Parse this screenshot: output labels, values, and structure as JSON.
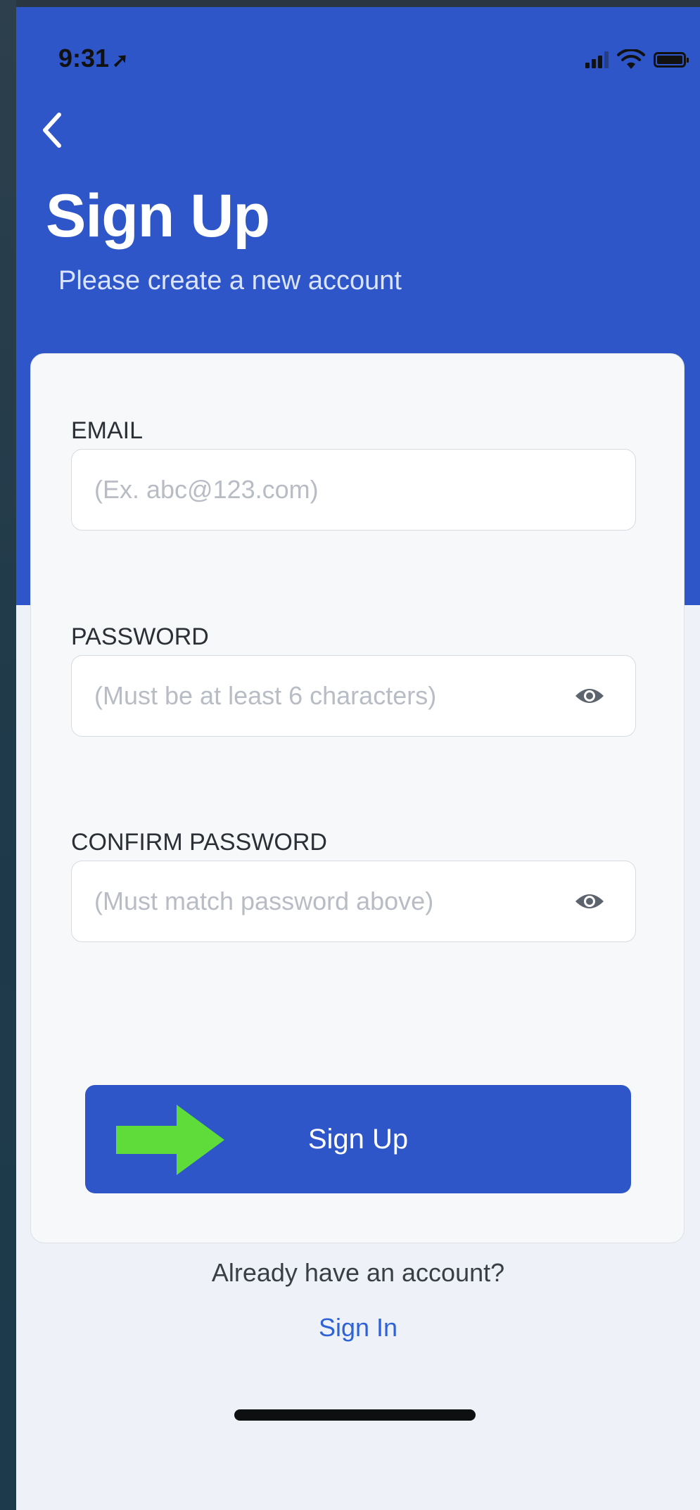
{
  "status_bar": {
    "time": "9:31",
    "location_icon": "location-arrow-icon",
    "icons": [
      "signal-icon",
      "wifi-icon",
      "battery-icon"
    ]
  },
  "header": {
    "back_icon": "chevron-left-icon",
    "title": "Sign Up",
    "subtitle": "Please create a new account"
  },
  "form": {
    "email": {
      "label": "EMAIL",
      "placeholder": "(Ex. abc@123.com)",
      "value": ""
    },
    "password": {
      "label": "PASSWORD",
      "placeholder": "(Must be at least 6 characters)",
      "value": "",
      "toggle_icon": "eye-icon"
    },
    "confirm_password": {
      "label": "CONFIRM PASSWORD",
      "placeholder": "(Must match password above)",
      "value": "",
      "toggle_icon": "eye-icon"
    },
    "submit_label": "Sign Up",
    "submit_annotation_icon": "arrow-right-icon"
  },
  "footer": {
    "prompt": "Already have an account?",
    "signin_link": "Sign In"
  },
  "colors": {
    "primary": "#2e56c8",
    "annotation_arrow": "#5fdc3a",
    "link": "#2d63d6",
    "background": "#eef2f8"
  }
}
